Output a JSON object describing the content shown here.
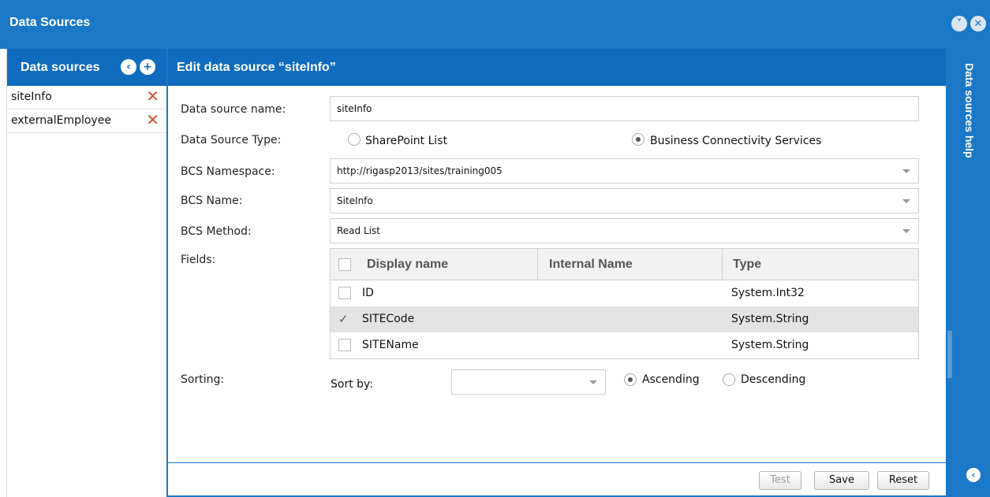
{
  "window": {
    "title": "Data Sources",
    "minimize_glyph": "˅",
    "close_glyph": "✕"
  },
  "sidebar": {
    "title": "Data sources",
    "back_glyph": "‹",
    "add_glyph": "+",
    "items": [
      {
        "label": "siteInfo",
        "delete_glyph": "✕"
      },
      {
        "label": "externalEmployee",
        "delete_glyph": "✕"
      }
    ]
  },
  "editor": {
    "title": "Edit data source “siteInfo”",
    "name_label": "Data source name:",
    "name_value": "siteInfo",
    "type_label": "Data Source Type:",
    "type_options": [
      {
        "label": "SharePoint List",
        "selected": false
      },
      {
        "label": "Business Connectivity Services",
        "selected": true
      }
    ],
    "namespace_label": "BCS Namespace:",
    "namespace_value": "http://rigasp2013/sites/training005",
    "bcs_name_label": "BCS Name:",
    "bcs_name_value": "SiteInfo",
    "method_label": "BCS Method:",
    "method_value": "Read List",
    "fields_label": "Fields:",
    "fields": {
      "headers": [
        "Display name",
        "Internal Name",
        "Type"
      ],
      "rows": [
        {
          "display": "ID",
          "internal": "",
          "type": "System.Int32",
          "checked": false
        },
        {
          "display": "SITECode",
          "internal": "",
          "type": "System.String",
          "checked": true
        },
        {
          "display": "SITEName",
          "internal": "",
          "type": "System.String",
          "checked": false
        }
      ],
      "check_glyph": "✓"
    },
    "sorting_label": "Sorting:",
    "sort_by_label": "Sort by:",
    "sort_by_value": "",
    "sort_order": [
      {
        "label": "Ascending",
        "selected": true
      },
      {
        "label": "Descending",
        "selected": false
      }
    ]
  },
  "footer": {
    "test_label": "Test",
    "save_label": "Save",
    "reset_label": "Reset"
  },
  "help_panel": {
    "title": "Data sources help",
    "back_glyph": "‹"
  },
  "colors": {
    "titlebar": "#1b78c6",
    "header": "#0f6cbd",
    "delete": "#d9532c"
  }
}
